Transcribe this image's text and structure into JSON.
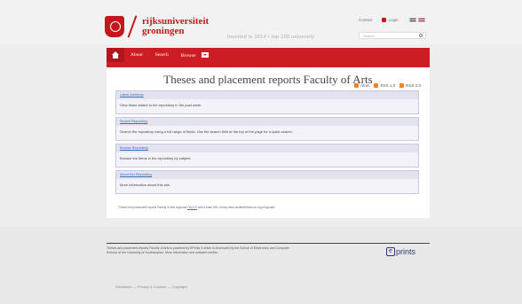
{
  "header": {
    "university_line1": "rijksuniversiteit",
    "university_line2": "groningen",
    "tagline": "founded in 1614 • top 100 university",
    "contact": "Contact",
    "login": "Login",
    "search_placeholder": "Search"
  },
  "nav": {
    "items": [
      "About",
      "Search",
      "Browse"
    ]
  },
  "main": {
    "title": "Theses and placement reports Faculty of Arts",
    "feeds": [
      "Atom",
      "RSS 1.0",
      "RSS 2.0"
    ],
    "boxes": [
      {
        "title": "Latest Additions",
        "body": "View items added to the repository in the past week."
      },
      {
        "title": "Search Repository",
        "body": "Search the repository using a full range of fields. Use the search field at the top of the page for a quick search."
      },
      {
        "title": "Browse Repository",
        "body": "Browse the items in the repository by subject."
      },
      {
        "title": "About this Repository",
        "body": "More information about this site."
      }
    ],
    "note_prefix": "Theses and placement reports Faculty of Arts supports",
    "note_link": "OAI 2.0",
    "note_suffix": "with a base URL of http://arts.studenttheses.ub.rug.nl/cgi/oai2"
  },
  "footer": {
    "text": "Theses and placement reports Faculty of Arts is powered by EPrints 3 which is developed by the School of Electronics and Computer Science at the University of Southampton. More information and software credits.",
    "brand": "prints",
    "brand_e": "e",
    "disclaimer": "Disclaimer — Privacy & Cookies — Copyright"
  }
}
